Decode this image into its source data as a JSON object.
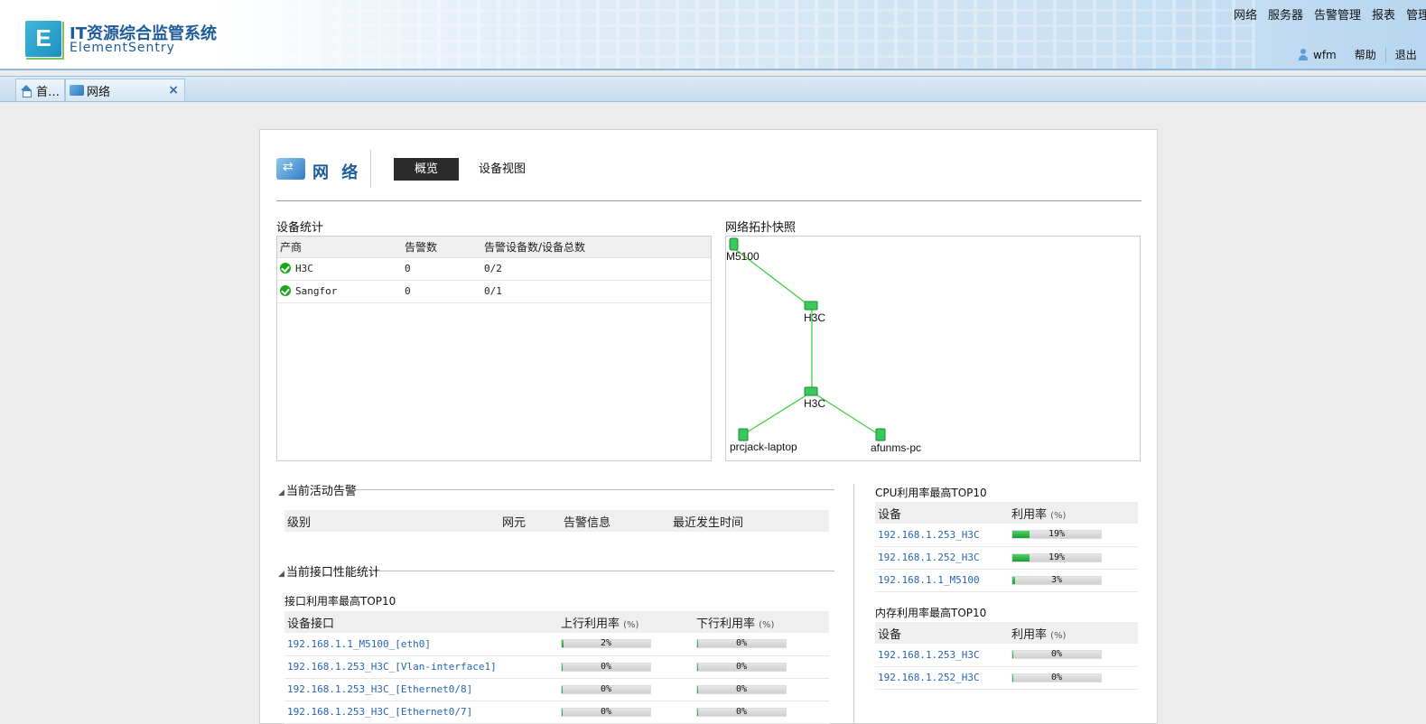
{
  "app": {
    "title_cn": "IT资源综合监管系统",
    "title_en": "ElementSentry",
    "logo_letter": "E",
    "top_nav": [
      "网络",
      "服务器",
      "告警管理",
      "报表",
      "管理"
    ],
    "user": "wfm",
    "help": "帮助",
    "logout": "退出"
  },
  "tabs": [
    {
      "label": "首…",
      "icon": "home-icon"
    },
    {
      "label": "网络",
      "icon": "network-icon",
      "close": "×"
    }
  ],
  "page": {
    "title": "网 络",
    "buttons": {
      "overview": "概览",
      "device_view": "设备视图"
    }
  },
  "device_stats": {
    "label": "设备统计",
    "headers": [
      "产商",
      "告警数",
      "告警设备数/设备总数"
    ],
    "rows": [
      {
        "vendor": "H3C",
        "alarms": "0",
        "ratio": "0/2"
      },
      {
        "vendor": "Sangfor",
        "alarms": "0",
        "ratio": "0/1"
      }
    ]
  },
  "topology": {
    "label": "网络拓扑快照",
    "nodes": [
      {
        "label": "M5100"
      },
      {
        "label": "H3C"
      },
      {
        "label": "H3C"
      },
      {
        "label": "prcjack-laptop"
      },
      {
        "label": "afunms-pc"
      }
    ]
  },
  "active_alarms": {
    "label": "当前活动告警",
    "headers": [
      "级别",
      "网元",
      "告警信息",
      "最近发生时间"
    ]
  },
  "interface_stats": {
    "label": "当前接口性能统计",
    "sub_label": "接口利用率最高TOP10",
    "headers": [
      "设备接口",
      "上行利用率",
      "下行利用率"
    ],
    "unit": "(%)",
    "rows": [
      {
        "name": "192.168.1.1_M5100_[eth0]",
        "up": "2%",
        "up_value": 2,
        "down": "0%",
        "down_value": 0
      },
      {
        "name": "192.168.1.253_H3C_[Vlan-interface1]",
        "up": "0%",
        "up_value": 0,
        "down": "0%",
        "down_value": 0
      },
      {
        "name": "192.168.1.253_H3C_[Ethernet0/8]",
        "up": "0%",
        "up_value": 0,
        "down": "0%",
        "down_value": 0
      },
      {
        "name": "192.168.1.253_H3C_[Ethernet0/7]",
        "up": "0%",
        "up_value": 0,
        "down": "0%",
        "down_value": 0
      }
    ]
  },
  "cpu_top": {
    "label": "CPU利用率最高TOP10",
    "headers": [
      "设备",
      "利用率"
    ],
    "unit": "(%)",
    "rows": [
      {
        "name": "192.168.1.253_H3C",
        "value": "19%",
        "pct": 19
      },
      {
        "name": "192.168.1.252_H3C",
        "value": "19%",
        "pct": 19
      },
      {
        "name": "192.168.1.1_M5100",
        "value": "3%",
        "pct": 3
      }
    ]
  },
  "mem_top": {
    "label": "内存利用率最高TOP10",
    "headers": [
      "设备",
      "利用率"
    ],
    "unit": "(%)",
    "rows": [
      {
        "name": "192.168.1.253_H3C",
        "value": "0%",
        "pct": 0
      },
      {
        "name": "192.168.1.252_H3C",
        "value": "0%",
        "pct": 0
      }
    ]
  }
}
